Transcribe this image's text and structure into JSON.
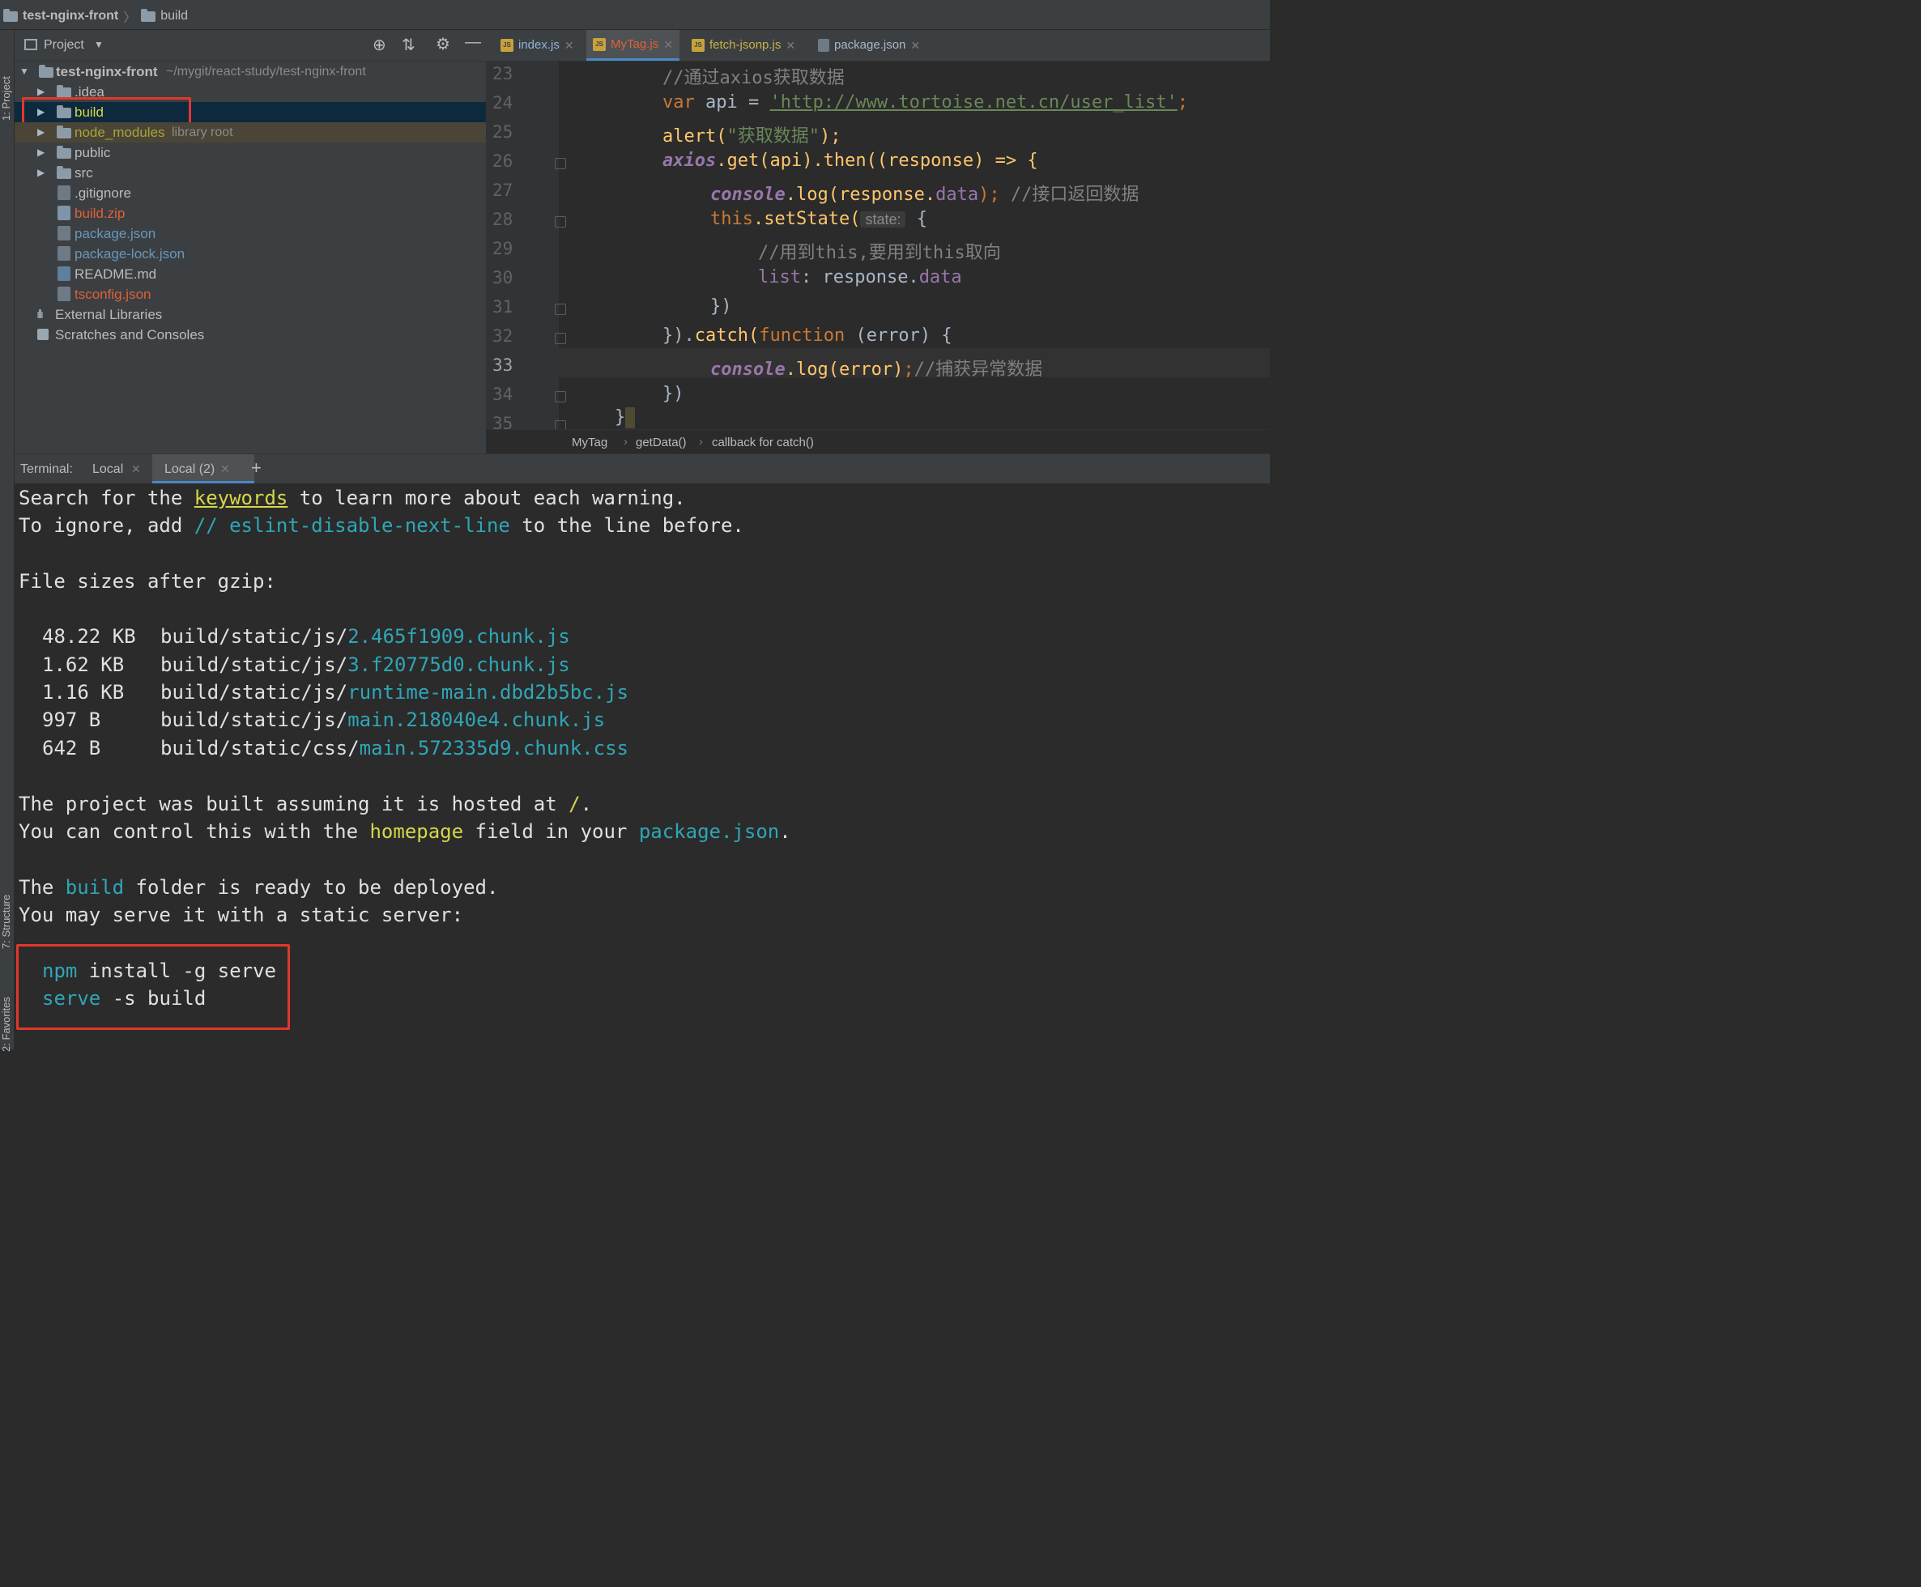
{
  "breadcrumb": {
    "project": "test-nginx-front",
    "folder": "build"
  },
  "left_strip": {
    "project": "1: Project",
    "structure": "7: Structure",
    "favorites": "2: Favorites"
  },
  "project_panel": {
    "title": "Project",
    "root": {
      "name": "test-nginx-front",
      "path": "~/mygit/react-study/test-nginx-front"
    },
    "items": [
      {
        "name": ".idea",
        "type": "folder"
      },
      {
        "name": "build",
        "type": "folder",
        "selected": true
      },
      {
        "name": "node_modules",
        "type": "folder",
        "suffix": "library root"
      },
      {
        "name": "public",
        "type": "folder"
      },
      {
        "name": "src",
        "type": "folder"
      },
      {
        "name": ".gitignore",
        "type": "file"
      },
      {
        "name": "build.zip",
        "type": "file"
      },
      {
        "name": "package.json",
        "type": "file"
      },
      {
        "name": "package-lock.json",
        "type": "file"
      },
      {
        "name": "README.md",
        "type": "file"
      },
      {
        "name": "tsconfig.json",
        "type": "file"
      }
    ],
    "external_libraries": "External Libraries",
    "scratches": "Scratches and Consoles"
  },
  "editor": {
    "tabs": [
      {
        "label": "index.js",
        "color": "#8fb3d9"
      },
      {
        "label": "MyTag.js",
        "color": "#e0603a"
      },
      {
        "label": "fetch-jsonp.js",
        "color": "#c7b14a"
      },
      {
        "label": "package.json",
        "color": "#a9b7c6"
      }
    ],
    "line_numbers": [
      "23",
      "24",
      "25",
      "26",
      "27",
      "28",
      "29",
      "30",
      "31",
      "32",
      "33",
      "34",
      "35"
    ],
    "lines": {
      "l23_comment": "//通过axios获取数据",
      "l24_var": "var",
      "l24_api": " api = ",
      "l24_url": "'http://www.tortoise.net.cn/user_list'",
      "l24_end": ";",
      "l25_alert": "alert(",
      "l25_str": "\"获取数据\"",
      "l25_end": ");",
      "l26_axios": "axios",
      "l26_get": ".get(api).then((response) => {",
      "l27_console": "console",
      "l27_log": ".log(response.",
      "l27_data": "data",
      "l27_end": ");",
      "l27_comment": " //接口返回数据",
      "l28_this": "this",
      "l28_setstate": ".setState(",
      "l28_hint": "state:",
      "l28_brace": " {",
      "l29_comment": "//用到this,要用到this取向",
      "l30_list": "list",
      "l30_rest": ": response.",
      "l30_data": "data",
      "l31": "})",
      "l32_start": "}).",
      "l32_catch": "catch",
      "l32_fn": "function",
      "l32_rest": " (error) {",
      "l33_console": "console",
      "l33_log": ".log(error)",
      "l33_semi": ";",
      "l33_comment": "//捕获异常数据",
      "l34": "})",
      "l35": "}"
    },
    "breadcrumbs": [
      "MyTag",
      "getData()",
      "callback for catch()"
    ]
  },
  "terminal": {
    "label": "Terminal:",
    "tabs": [
      "Local",
      "Local (2)"
    ],
    "add": "+",
    "lines": {
      "search_a": "Search for the ",
      "search_kw": "keywords",
      "search_b": " to learn more about each warning.",
      "ignore_a": "To ignore, add ",
      "ignore_code": "// eslint-disable-next-line",
      "ignore_b": " to the line before.",
      "filesizes": "File sizes after gzip:",
      "files": [
        {
          "size": "48.22 KB",
          "dir": "build/static/js/",
          "name": "2.465f1909.chunk.js"
        },
        {
          "size": "1.62 KB",
          "dir": "build/static/js/",
          "name": "3.f20775d0.chunk.js"
        },
        {
          "size": "1.16 KB",
          "dir": "build/static/js/",
          "name": "runtime-main.dbd2b5bc.js"
        },
        {
          "size": "997 B",
          "dir": "build/static/js/",
          "name": "main.218040e4.chunk.js"
        },
        {
          "size": "642 B",
          "dir": "build/static/css/",
          "name": "main.572335d9.chunk.css"
        }
      ],
      "hosted_a": "The project was built assuming it is hosted at ",
      "hosted_slash": "/",
      "hosted_b": ".",
      "control_a": "You can control this with the ",
      "control_hp": "homepage",
      "control_b": " field in your ",
      "control_pkg": "package.json",
      "control_c": ".",
      "ready_a": "The ",
      "ready_build": "build",
      "ready_b": " folder is ready to be deployed.",
      "serve_line": "You may serve it with a static server:",
      "cmd1_a": "npm",
      "cmd1_b": " install -g serve",
      "cmd2_a": "serve",
      "cmd2_b": " -s build"
    }
  }
}
